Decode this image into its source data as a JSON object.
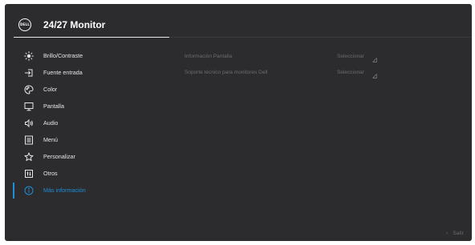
{
  "brand": {
    "logo_text": "DELL"
  },
  "header": {
    "title": "24/27 Monitor"
  },
  "menu": {
    "items": [
      {
        "label": "Brillo/Contraste",
        "icon": "brightness-icon",
        "active": false
      },
      {
        "label": "Fuente entrada",
        "icon": "input-source-icon",
        "active": false
      },
      {
        "label": "Color",
        "icon": "color-palette-icon",
        "active": false
      },
      {
        "label": "Pantalla",
        "icon": "display-icon",
        "active": false
      },
      {
        "label": "Audio",
        "icon": "speaker-icon",
        "active": false
      },
      {
        "label": "Menú",
        "icon": "menu-list-icon",
        "active": false
      },
      {
        "label": "Personalizar",
        "icon": "star-icon",
        "active": false
      },
      {
        "label": "Otros",
        "icon": "others-icon",
        "active": false
      },
      {
        "label": "Más información",
        "icon": "info-icon",
        "active": true
      }
    ]
  },
  "submenu": {
    "rows": [
      {
        "label": "Información Pantalla",
        "value": "Seleccionar"
      },
      {
        "label": "Soporte técnico para monitores Dell",
        "value": "Seleccionar"
      }
    ]
  },
  "footer": {
    "exit_label": "Salir"
  },
  "colors": {
    "background": "#2c2c2e",
    "accent": "#1f8fd8",
    "text": "#e6e6e6",
    "muted": "#6c6c6e"
  }
}
